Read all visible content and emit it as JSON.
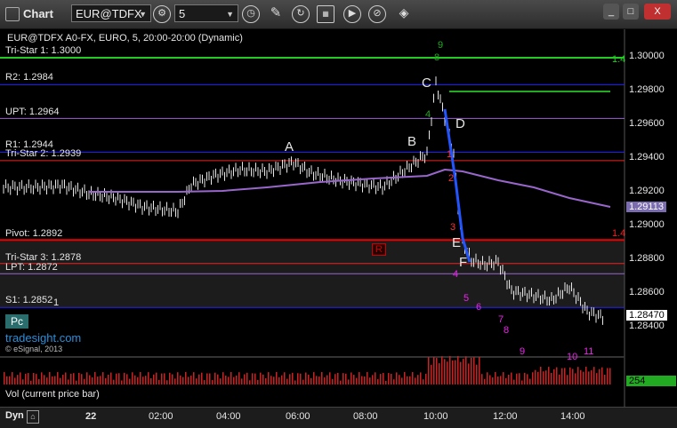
{
  "window": {
    "app_name": "Chart",
    "symbol_value": "EUR@TDFX",
    "interval_value": "5",
    "minimize": "_",
    "maximize": "□",
    "close": "X"
  },
  "chart": {
    "header": "EUR@TDFX A0-FX, EURO, 5, 20:00-20:00 (Dynamic)",
    "levels": [
      {
        "label": "Tri-Star 1: 1.3000",
        "value": 1.3,
        "color": "#22cc22"
      },
      {
        "label": "R2: 1.2984",
        "value": 1.2984,
        "color": "#2222ff"
      },
      {
        "label": "UPT: 1.2964",
        "value": 1.2964,
        "color": "#9966cc"
      },
      {
        "label": "R1: 1.2944",
        "value": 1.2944,
        "color": "#2222ff"
      },
      {
        "label": "Tri-Star 2: 1.2939",
        "value": 1.2939,
        "color": "#ee2222"
      },
      {
        "label": "Pivot: 1.2892",
        "value": 1.2892,
        "color": "#ee0000"
      },
      {
        "label": "Tri-Star 3: 1.2878",
        "value": 1.2878,
        "color": "#ee2222"
      },
      {
        "label": "LPT: 1.2872",
        "value": 1.2872,
        "color": "#9966cc"
      },
      {
        "label": "S1: 1.2852",
        "value": 1.2852,
        "color": "#2222ff"
      }
    ],
    "price_axis_ticks": [
      "1.30000",
      "1.29800",
      "1.29600",
      "1.29400",
      "1.29200",
      "1.29000",
      "1.28800",
      "1.28600",
      "1.28400"
    ],
    "right_edge_tags": [
      "1.4",
      "1.4"
    ],
    "ma_value_tag": "1.29113",
    "price_tag": "1.28470",
    "vol_tag": "254",
    "time_ticks": [
      "22",
      "02:00",
      "04:00",
      "06:00",
      "08:00",
      "10:00",
      "12:00",
      "14:00"
    ],
    "annotations": [
      "A",
      "B",
      "C",
      "D",
      "E",
      "F"
    ],
    "r_box": "R",
    "pc_button": "Pc",
    "watermark": "tradesight.com",
    "copyright": "© eSignal, 2013",
    "s1_suffix": "1",
    "vol_label": "Vol (current price bar)",
    "dyn_label": "Dyn"
  },
  "counts": {
    "green_top": "9",
    "green_8": "8",
    "green_4": "4",
    "red_1": "1",
    "red_2": "2",
    "red_3": "3",
    "m4": "4",
    "m5": "5",
    "m6": "6",
    "m7": "7",
    "m8": "8",
    "m9": "9",
    "m10": "10",
    "m11": "11"
  },
  "colors": {
    "background": "#000000",
    "up_candle": "#ffffff",
    "down_candle": "#ffffff",
    "ma": "#9966cc",
    "price_line": "#2255ff",
    "green_count": "#22aa22",
    "magenta_count": "#ee22ee",
    "red_count": "#ff3333"
  }
}
